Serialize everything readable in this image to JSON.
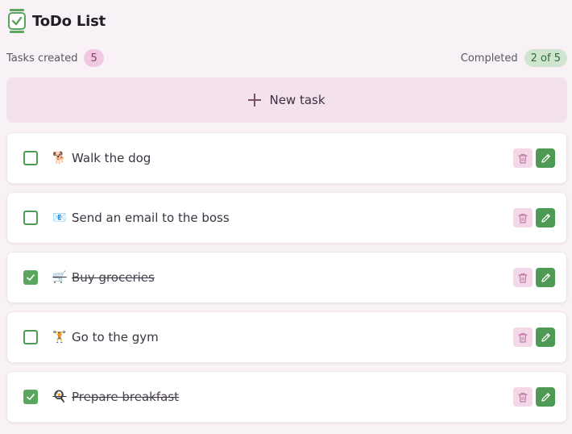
{
  "app": {
    "title": "ToDo List"
  },
  "stats": {
    "created_label": "Tasks created",
    "created_count": "5",
    "completed_label": "Completed",
    "completed_count": "2 of 5"
  },
  "new_task": {
    "label": "New task"
  },
  "tasks": [
    {
      "emoji": "🐕",
      "text": "Walk the dog",
      "done": false
    },
    {
      "emoji": "📧",
      "text": "Send an email to the boss",
      "done": false
    },
    {
      "emoji": "🛒",
      "text": "Buy groceries",
      "done": true
    },
    {
      "emoji": "🏋",
      "text": "Go to the gym",
      "done": false
    },
    {
      "emoji": "🍳",
      "text": "Prepare breakfast",
      "done": true
    }
  ],
  "icons": {
    "logo": "checklist-icon",
    "plus": "plus-icon",
    "check": "check-icon",
    "delete": "trash-icon",
    "edit": "pencil-icon"
  },
  "colors": {
    "accent_green": "#5aa65e",
    "accent_pink": "#f0c9e0",
    "background": "#f8f1f5"
  }
}
